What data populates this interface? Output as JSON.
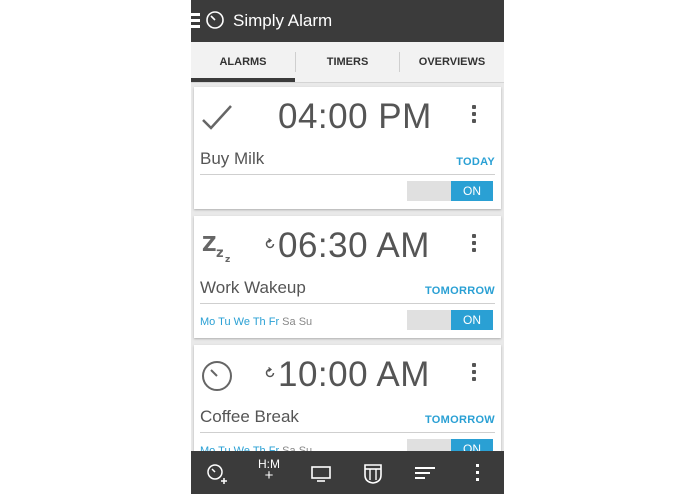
{
  "app": {
    "title": "Simply Alarm"
  },
  "tabs": [
    {
      "label": "ALARMS",
      "active": true
    },
    {
      "label": "TIMERS",
      "active": false
    },
    {
      "label": "OVERVIEWS",
      "active": false
    }
  ],
  "alarms": [
    {
      "time": "04:00 PM",
      "label": "Buy Milk",
      "when": "TODAY",
      "icon": "checkmark-icon",
      "repeat": false,
      "days": [],
      "toggle": "ON"
    },
    {
      "time": "06:30 AM",
      "label": "Work Wakeup",
      "when": "TOMORROW",
      "icon": "snooze-icon",
      "repeat": true,
      "days": [
        {
          "d": "Mo",
          "on": true
        },
        {
          "d": "Tu",
          "on": true
        },
        {
          "d": "We",
          "on": true
        },
        {
          "d": "Th",
          "on": true
        },
        {
          "d": "Fr",
          "on": true
        },
        {
          "d": "Sa",
          "on": false
        },
        {
          "d": "Su",
          "on": false
        }
      ],
      "toggle": "ON"
    },
    {
      "time": "10:00 AM",
      "label": "Coffee Break",
      "when": "TOMORROW",
      "icon": "clock-icon",
      "repeat": true,
      "days": [
        {
          "d": "Mo",
          "on": true
        },
        {
          "d": "Tu",
          "on": true
        },
        {
          "d": "We",
          "on": true
        },
        {
          "d": "Th",
          "on": true
        },
        {
          "d": "Fr",
          "on": true
        },
        {
          "d": "Sa",
          "on": false
        },
        {
          "d": "Su",
          "on": false
        }
      ],
      "toggle": "ON"
    }
  ],
  "bottom_bar": {
    "hm_line1": "H:M",
    "hm_line2": "+",
    "icons": [
      "add-alarm-icon",
      "add-time-icon",
      "display-icon",
      "calendar-icon",
      "sort-icon",
      "overflow-icon"
    ]
  },
  "colors": {
    "accent": "#2aa0d4",
    "bar": "#3b3b3b",
    "background": "#e9e9e9"
  }
}
